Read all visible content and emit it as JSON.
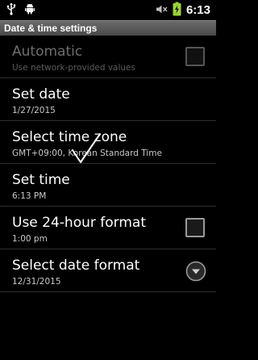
{
  "status_bar": {
    "time": "6:13",
    "left_icons": [
      "usb-icon",
      "android-debug-icon"
    ],
    "right_icons": [
      "volume-muted-icon",
      "battery-charging-icon"
    ]
  },
  "title_bar": {
    "title": "Date & time settings"
  },
  "settings": [
    {
      "label": "Automatic",
      "summary": "Use network-provided values",
      "control": "checkbox",
      "checked": false,
      "enabled": false
    },
    {
      "label": "Set date",
      "summary": "1/27/2015"
    },
    {
      "label": "Select time zone",
      "summary": "GMT+09:00, Korean Standard Time"
    },
    {
      "label": "Set time",
      "summary": "6:13 PM"
    },
    {
      "label": "Use 24-hour format",
      "summary": "1:00 pm",
      "control": "checkbox",
      "checked": false,
      "enabled": true
    },
    {
      "label": "Select date format",
      "summary": "12/31/2015",
      "control": "dropdown"
    }
  ],
  "colors": {
    "background": "#000000",
    "title_bar": "#5a5a5a",
    "text": "#ffffff",
    "summary": "#c8c8c8",
    "disabled": "#6e6e6e"
  },
  "overlay": {
    "icon": "checkmark-icon"
  }
}
